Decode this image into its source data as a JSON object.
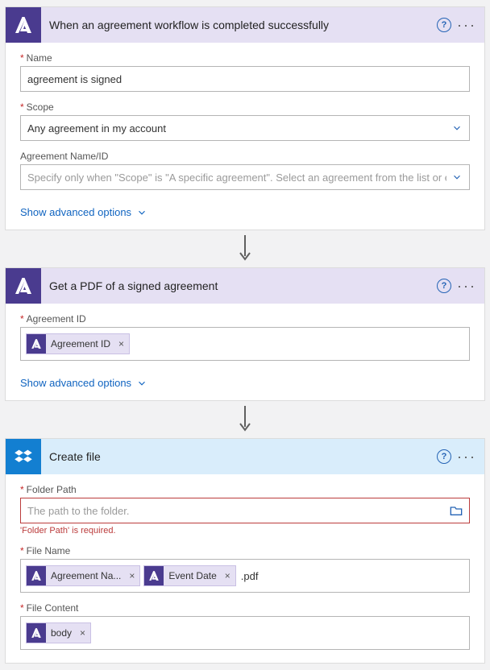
{
  "cards": [
    {
      "title": "When an agreement workflow is completed successfully",
      "advanced": "Show advanced options",
      "fields": {
        "name_label": "Name",
        "name_value": "agreement is signed",
        "scope_label": "Scope",
        "scope_value": "Any agreement in my account",
        "agid_label": "Agreement Name/ID",
        "agid_placeholder": "Specify only when \"Scope\" is \"A specific agreement\". Select an agreement from the list or enter th"
      }
    },
    {
      "title": "Get a PDF of a signed agreement",
      "advanced": "Show advanced options",
      "fields": {
        "agid_label": "Agreement ID",
        "token": "Agreement ID"
      }
    },
    {
      "title": "Create file",
      "fields": {
        "folder_label": "Folder Path",
        "folder_placeholder": "The path to the folder.",
        "folder_error": "'Folder Path' is required.",
        "filename_label": "File Name",
        "filename_token1": "Agreement Na...",
        "filename_token2": "Event Date",
        "filename_suffix": ".pdf",
        "filecontent_label": "File Content",
        "filecontent_token": "body"
      }
    }
  ]
}
